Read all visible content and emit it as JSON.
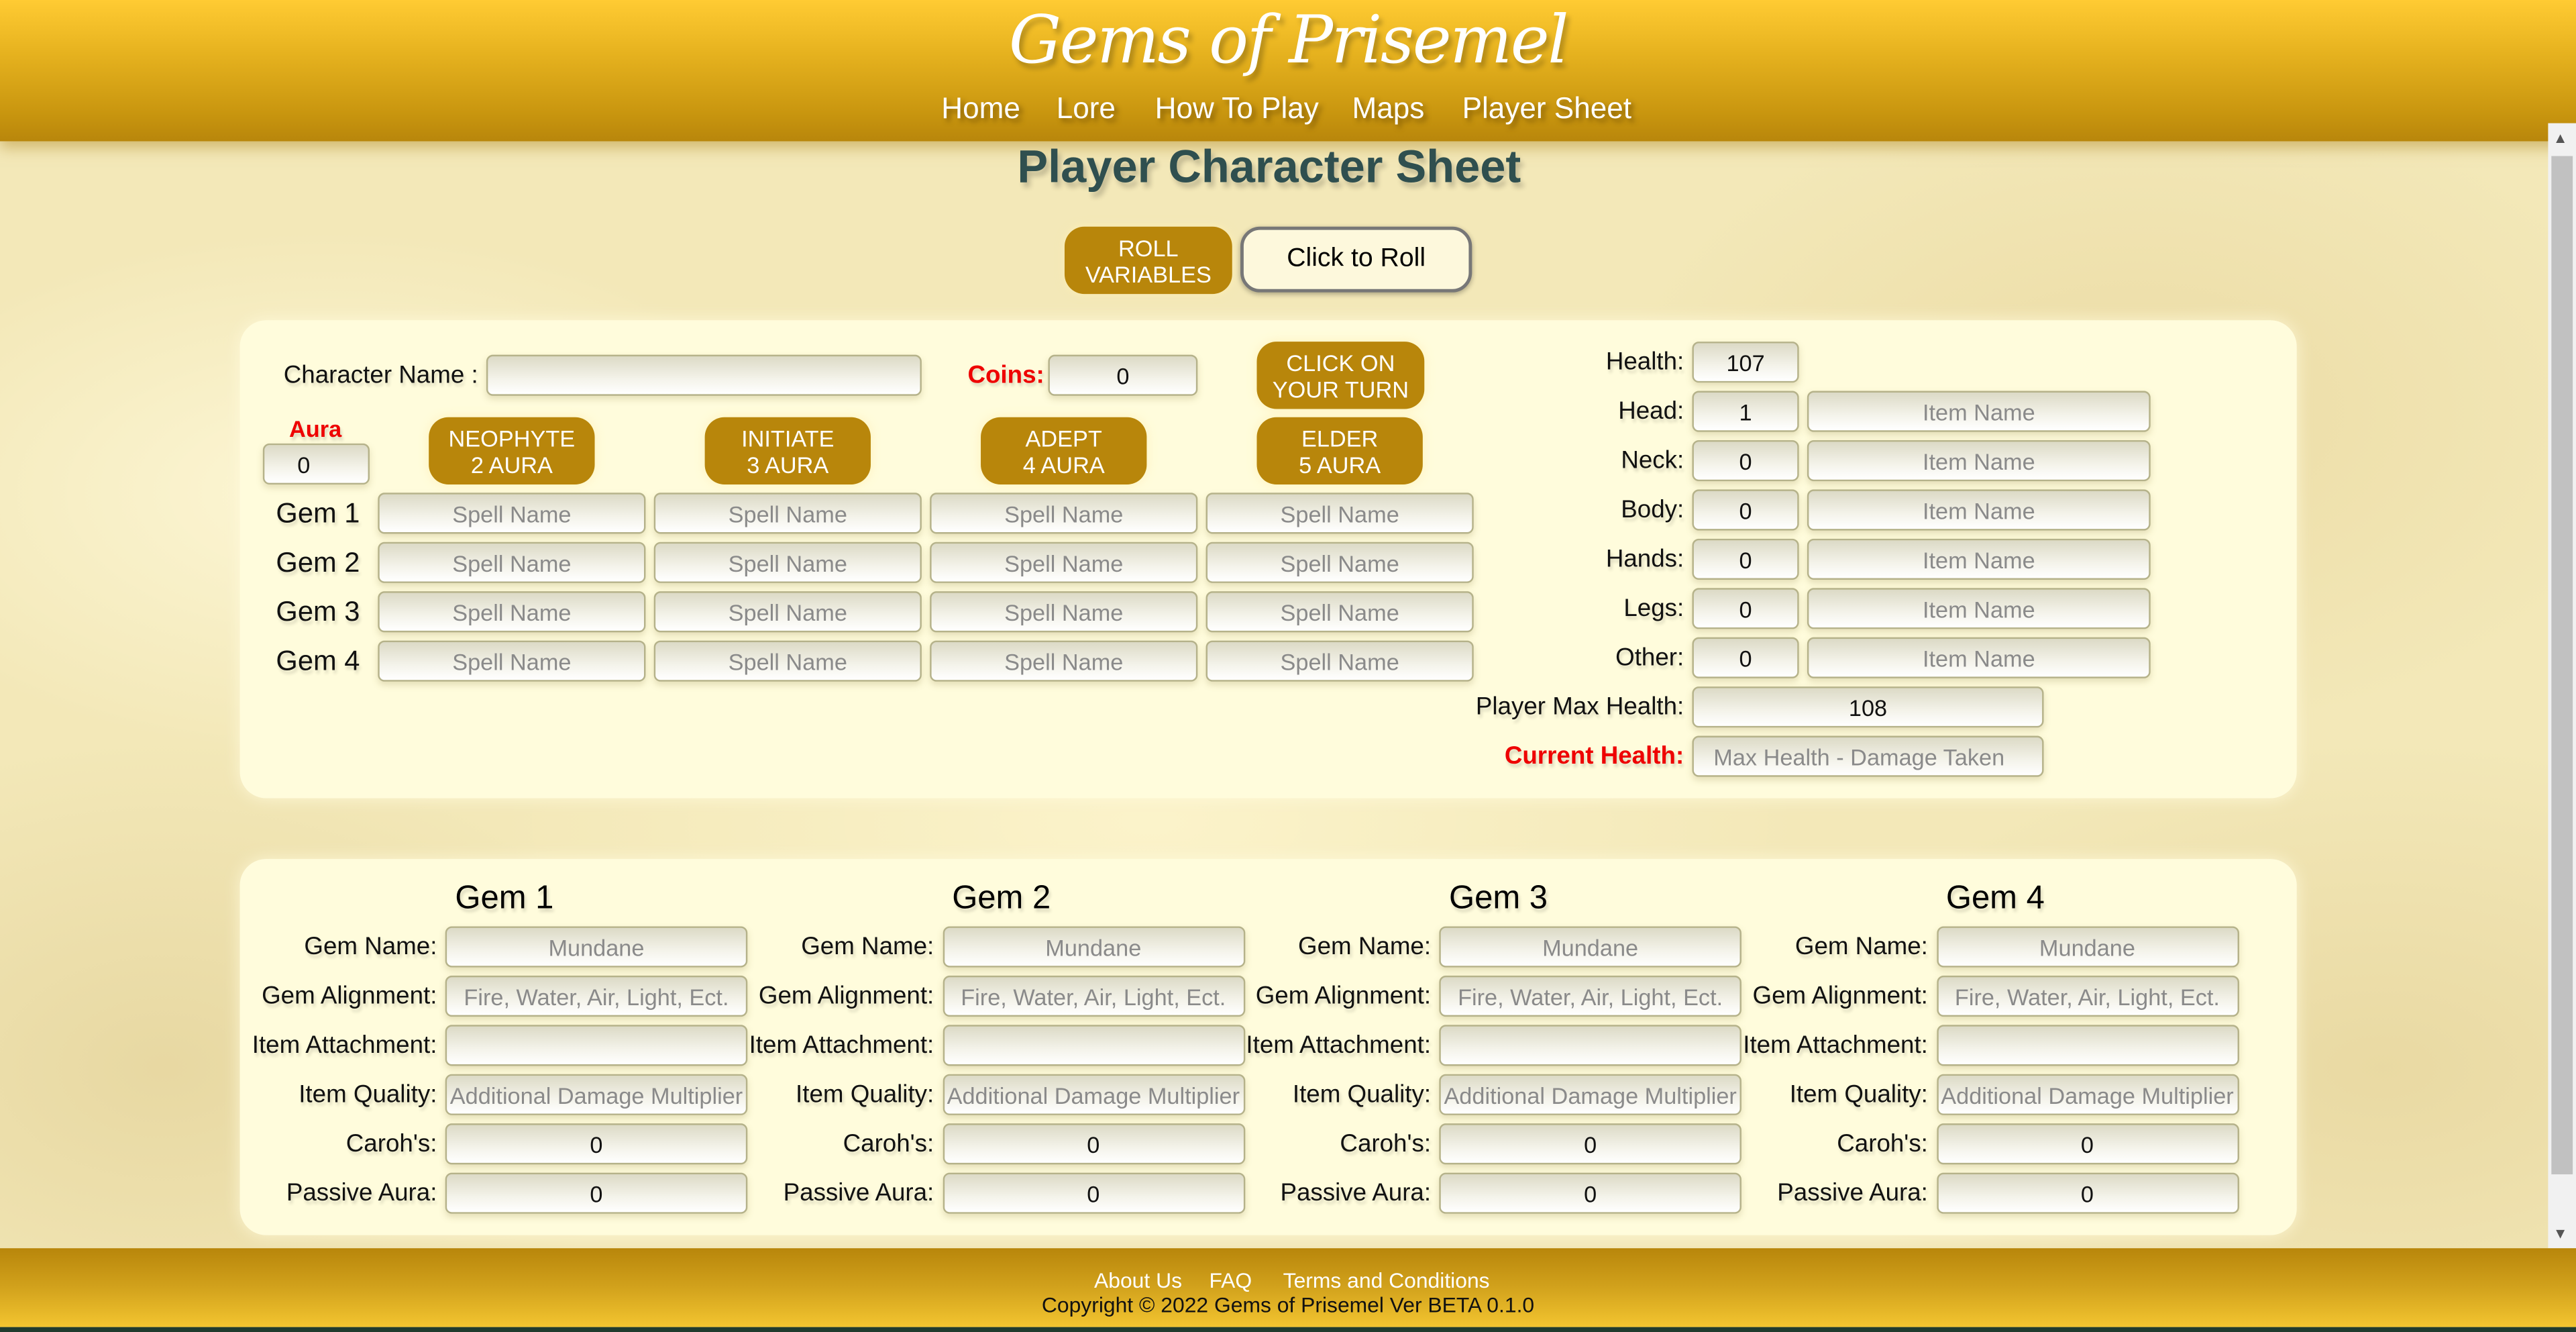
{
  "header": {
    "title": "Gems of Prisemel",
    "nav": [
      "Home",
      "Lore",
      "How To Play",
      "Maps",
      "Player Sheet"
    ]
  },
  "page_title": "Player Character Sheet",
  "roll": {
    "roll_variables_label": [
      "ROLL",
      "VARIABLES"
    ],
    "click_to_roll_label": "Click to Roll"
  },
  "character": {
    "name_label": "Character Name :",
    "name_value": "",
    "coins_label": "Coins:",
    "coins_value": "0",
    "turn_button": [
      "CLICK ON",
      "YOUR TURN"
    ],
    "aura_label": "Aura",
    "aura_value": "0"
  },
  "tiers": [
    {
      "l1": "NEOPHYTE",
      "l2": "2 AURA"
    },
    {
      "l1": "INITIATE",
      "l2": "3 AURA"
    },
    {
      "l1": "ADEPT",
      "l2": "4 AURA"
    },
    {
      "l1": "ELDER",
      "l2": "5 AURA"
    }
  ],
  "spells": {
    "rows": [
      "Gem 1",
      "Gem 2",
      "Gem 3",
      "Gem 4"
    ],
    "placeholder": "Spell Name"
  },
  "equipment": {
    "health_label": "Health:",
    "health_value": "107",
    "slots": [
      {
        "label": "Head:",
        "value": "1"
      },
      {
        "label": "Neck:",
        "value": "0"
      },
      {
        "label": "Body:",
        "value": "0"
      },
      {
        "label": "Hands:",
        "value": "0"
      },
      {
        "label": "Legs:",
        "value": "0"
      },
      {
        "label": "Other:",
        "value": "0"
      }
    ],
    "item_placeholder": "Item Name",
    "max_health_label": "Player Max Health:",
    "max_health_value": "108",
    "current_health_label": "Current Health:",
    "current_health_placeholder": "Max Health - Damage Taken"
  },
  "gems": {
    "titles": [
      "Gem 1",
      "Gem 2",
      "Gem 3",
      "Gem 4"
    ],
    "fields": [
      {
        "label": "Gem Name:",
        "placeholder": "Mundane",
        "value": ""
      },
      {
        "label": "Gem Alignment:",
        "placeholder": "Fire, Water, Air, Light, Ect.",
        "value": ""
      },
      {
        "label": "Item Attachment:",
        "placeholder": "",
        "value": ""
      },
      {
        "label": "Item Quality:",
        "placeholder": "Additional Damage Multiplier",
        "value": ""
      },
      {
        "label": "Caroh's:",
        "placeholder": "",
        "value": "0"
      },
      {
        "label": "Passive Aura:",
        "placeholder": "",
        "value": "0"
      }
    ]
  },
  "footer": {
    "links": [
      "About Us",
      "FAQ",
      "Terms and Conditions"
    ],
    "copyright": "Copyright © 2022 Gems of Prisemel Ver BETA 0.1.0"
  },
  "colors": {
    "gold": "#b8860b",
    "title": "#2f4f4f",
    "alert": "#ee0000",
    "panel": "#fffcdc"
  }
}
